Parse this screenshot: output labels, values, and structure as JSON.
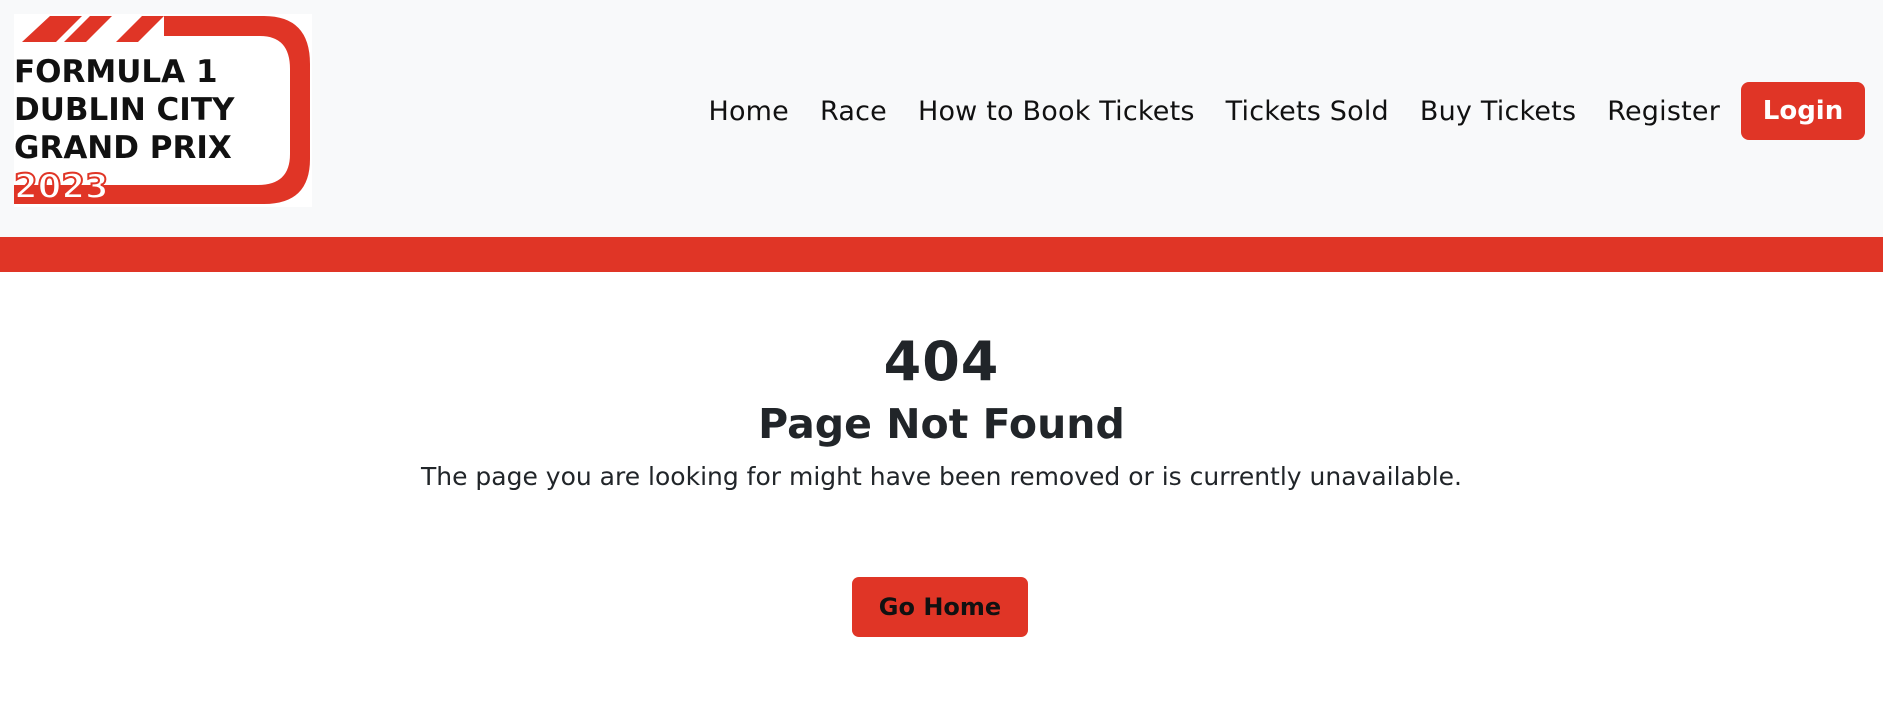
{
  "brand": {
    "logo_lines": [
      "FORMULA 1",
      "DUBLIN CITY",
      "GRAND PRIX",
      "2023"
    ],
    "accent_color": "#e03526"
  },
  "nav": {
    "items": [
      {
        "label": "Home"
      },
      {
        "label": "Race"
      },
      {
        "label": "How to Book Tickets"
      },
      {
        "label": "Tickets Sold"
      },
      {
        "label": "Buy Tickets"
      },
      {
        "label": "Register"
      }
    ],
    "login_label": "Login"
  },
  "error": {
    "code": "404",
    "title": "Page Not Found",
    "message": "The page you are looking for might have been removed or is currently unavailable.",
    "home_button_label": "Go Home"
  }
}
